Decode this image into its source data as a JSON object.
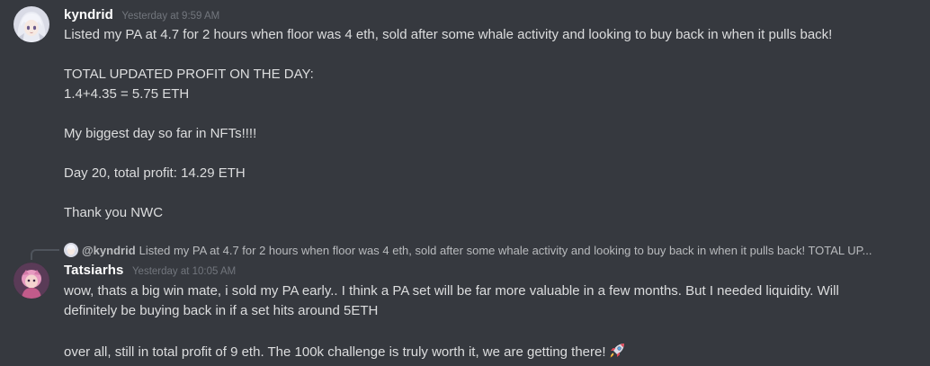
{
  "messages": [
    {
      "username": "kyndrid",
      "timestamp": "Yesterday at 9:59 AM",
      "avatar_icon": "anime-girl-avatar",
      "lines": [
        "Listed my PA at 4.7 for 2 hours when floor was 4 eth, sold after some whale activity and looking to buy back in when it pulls back!",
        "",
        "TOTAL UPDATED PROFIT ON THE DAY:",
        "1.4+4.35 = 5.75 ETH",
        "",
        "My biggest day so far in NFTs!!!!",
        "",
        "Day 20, total profit: 14.29 ETH",
        "",
        "Thank you NWC"
      ]
    },
    {
      "username": "Tatsiarhs",
      "timestamp": "Yesterday at 10:05 AM",
      "avatar_icon": "pink-character-avatar",
      "reply": {
        "username": "@kyndrid",
        "text": "Listed my PA at 4.7 for 2 hours when floor was 4 eth, sold after some whale activity and looking to buy back in when it pulls back!  TOTAL UP..."
      },
      "lines": [
        "wow, thats a big win mate, i sold my PA early.. I think a PA set will be far more valuable in a few months. But I needed liquidity. Will",
        "definitely be buying back in if a set hits around 5ETH",
        "",
        "over all, still in total profit of 9 eth. The 100k challenge is truly worth it, we are getting there!"
      ],
      "emoji": "rocket-emoji"
    }
  ]
}
